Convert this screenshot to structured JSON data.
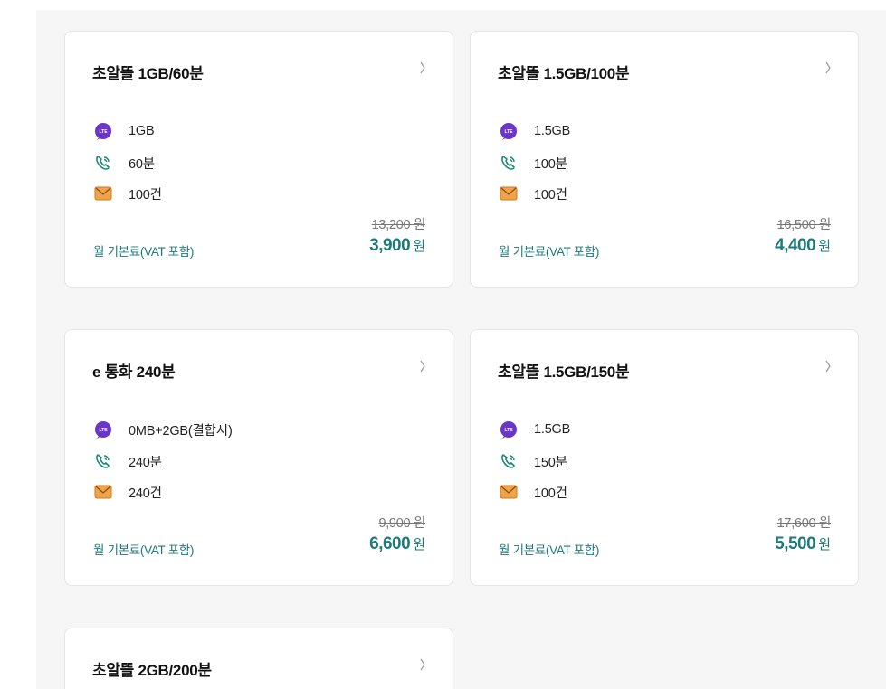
{
  "plans": [
    {
      "name": "초알뜰 1GB/60분",
      "data": "1GB",
      "voice": "60분",
      "sms": "100건",
      "vat_label": "월 기본료(VAT 포함)",
      "original_price": "13,200 원",
      "price": "3,900",
      "price_unit": "원"
    },
    {
      "name": "초알뜰 1.5GB/100분",
      "data": "1.5GB",
      "voice": "100분",
      "sms": "100건",
      "vat_label": "월 기본료(VAT 포함)",
      "original_price": "16,500 원",
      "price": "4,400",
      "price_unit": "원"
    },
    {
      "name": "e 통화 240분",
      "data": "0MB+2GB(결합시)",
      "voice": "240분",
      "sms": "240건",
      "vat_label": "월 기본료(VAT 포함)",
      "original_price": "9,900 원",
      "price": "6,600",
      "price_unit": "원"
    },
    {
      "name": "초알뜰 1.5GB/150분",
      "data": "1.5GB",
      "voice": "150분",
      "sms": "100건",
      "vat_label": "월 기본료(VAT 포함)",
      "original_price": "17,600 원",
      "price": "5,500",
      "price_unit": "원"
    },
    {
      "name": "초알뜰 2GB/200분"
    }
  ],
  "icons": {
    "data": "lte-icon",
    "voice": "phone-icon",
    "sms": "message-icon",
    "chevron": "chevron-right-icon"
  },
  "icon_labels": {
    "lte": "LTE"
  },
  "colors": {
    "accent": "#1e7a78",
    "lte_icon": "#6a35c9",
    "phone_icon": "#1e8a78",
    "message_icon": "#f0a44a"
  }
}
